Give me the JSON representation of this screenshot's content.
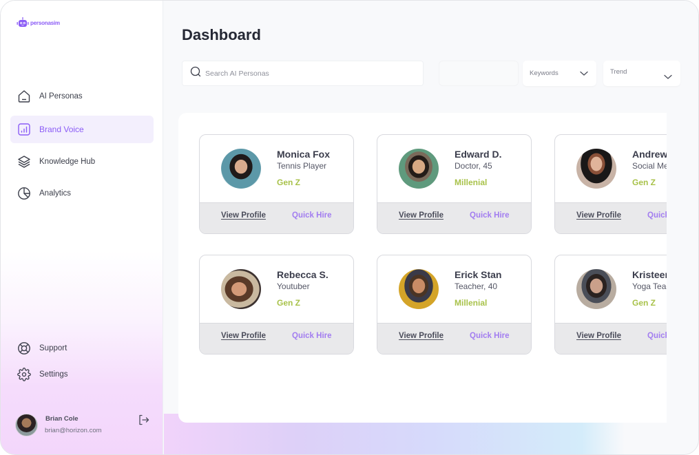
{
  "app": {
    "brand": "personasim",
    "brand_color": "#8b5cf6"
  },
  "sidebar": {
    "items": [
      {
        "label": "AI Personas",
        "icon": "home-icon",
        "active": false
      },
      {
        "label": "Brand Voice",
        "icon": "bar-chart-icon",
        "active": true
      },
      {
        "label": "Knowledge Hub",
        "icon": "layers-icon",
        "active": false
      },
      {
        "label": "Analytics",
        "icon": "pie-chart-icon",
        "active": false
      }
    ],
    "bottom_items": [
      {
        "label": "Support",
        "icon": "lifebuoy-icon"
      },
      {
        "label": "Settings",
        "icon": "gear-icon"
      }
    ],
    "user": {
      "name": "Brian Cole",
      "email": "brian@horizon.com"
    }
  },
  "header": {
    "title": "Dashboard",
    "search_placeholder": "Search AI Personas",
    "search_value": "",
    "filters": [
      {
        "label": "Keywords"
      },
      {
        "label": "Trend"
      }
    ]
  },
  "personas": [
    {
      "name": "Monica Fox",
      "role": "Tennis Player",
      "generation": "Gen Z",
      "view_label": "View Profile",
      "hire_label": "Quick Hire"
    },
    {
      "name": "Edward D.",
      "role": "Doctor, 45",
      "generation": "Millenial",
      "view_label": "View Profile",
      "hire_label": "Quick Hire"
    },
    {
      "name": "Andrew M.",
      "role": "Social Media",
      "generation": "Gen Z",
      "view_label": "View Profile",
      "hire_label": "Quick Hire"
    },
    {
      "name": "Rebecca S.",
      "role": "Youtuber",
      "generation": "Gen Z",
      "view_label": "View Profile",
      "hire_label": "Quick Hire"
    },
    {
      "name": "Erick Stan",
      "role": "Teacher, 40",
      "generation": "Millenial",
      "view_label": "View Profile",
      "hire_label": "Quick Hire"
    },
    {
      "name": "Kristeen M.",
      "role": "Yoga Teacher",
      "generation": "Gen Z",
      "view_label": "View Profile",
      "hire_label": "Quick Hire"
    }
  ],
  "colors": {
    "accent": "#8b5cf6",
    "generation": "#a8c24a",
    "active_bg": "#f3effd"
  }
}
